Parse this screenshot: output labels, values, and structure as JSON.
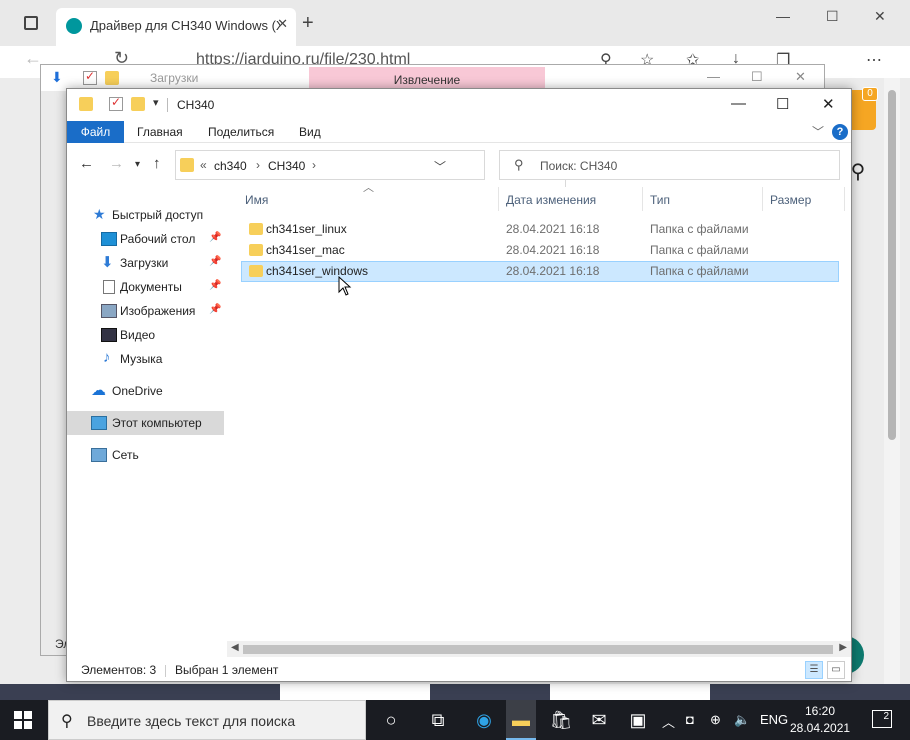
{
  "browser": {
    "tab_title": "Драйвер для CH340 Windows (Х",
    "tab_close": "✕",
    "new_tab": "+",
    "url": "https://iarduino.ru/file/230.html",
    "cart_count": "0",
    "window_controls": {
      "minimize": "—",
      "maximize": "☐",
      "close": "✕"
    }
  },
  "extraction_window": {
    "title": "Загрузки",
    "badge": "Извлечение",
    "partial_status": "Эл",
    "window_controls": {
      "minimize": "—",
      "maximize": "☐",
      "close": "✕"
    }
  },
  "explorer": {
    "title": "CH340",
    "window_controls": {
      "minimize": "—",
      "maximize": "☐",
      "close": "✕"
    },
    "ribbon": {
      "file": "Файл",
      "tabs": [
        "Главная",
        "Поделиться",
        "Вид"
      ],
      "help": "?"
    },
    "address": {
      "overflow": "«",
      "crumbs": [
        "ch340",
        "CH340"
      ],
      "separator": "›"
    },
    "search_placeholder": "Поиск: CH340",
    "sidebar": [
      {
        "label": "Быстрый доступ",
        "icon": "star-icon",
        "pinned": false,
        "active": false
      },
      {
        "label": "Рабочий стол",
        "icon": "desktop-icon",
        "pinned": true,
        "active": false
      },
      {
        "label": "Загрузки",
        "icon": "download-icon",
        "pinned": true,
        "active": false
      },
      {
        "label": "Документы",
        "icon": "documents-icon",
        "pinned": true,
        "active": false
      },
      {
        "label": "Изображения",
        "icon": "images-icon",
        "pinned": true,
        "active": false
      },
      {
        "label": "Видео",
        "icon": "video-icon",
        "pinned": false,
        "active": false
      },
      {
        "label": "Музыка",
        "icon": "music-icon",
        "pinned": false,
        "active": false
      },
      {
        "label": "OneDrive",
        "icon": "cloud-icon",
        "pinned": false,
        "active": false
      },
      {
        "label": "Этот компьютер",
        "icon": "computer-icon",
        "pinned": false,
        "active": true
      },
      {
        "label": "Сеть",
        "icon": "network-icon",
        "pinned": false,
        "active": false
      }
    ],
    "columns": [
      "Имя",
      "Дата изменения",
      "Тип",
      "Размер"
    ],
    "files": [
      {
        "name": "ch341ser_linux",
        "date": "28.04.2021 16:18",
        "type": "Папка с файлами",
        "selected": false
      },
      {
        "name": "ch341ser_mac",
        "date": "28.04.2021 16:18",
        "type": "Папка с файлами",
        "selected": false
      },
      {
        "name": "ch341ser_windows",
        "date": "28.04.2021 16:18",
        "type": "Папка с файлами",
        "selected": true
      }
    ],
    "status": {
      "count": "Элементов: 3",
      "selected": "Выбран 1 элемент"
    }
  },
  "taskbar": {
    "search_text": "Введите здесь текст для поиска",
    "language": "ENG",
    "time": "16:20",
    "date": "28.04.2021",
    "notifications": "2"
  },
  "colors": {
    "accent": "#1a6dc8",
    "selection": "#cce8ff",
    "folder": "#f7cf5a",
    "taskbar": "#1a1c22"
  }
}
